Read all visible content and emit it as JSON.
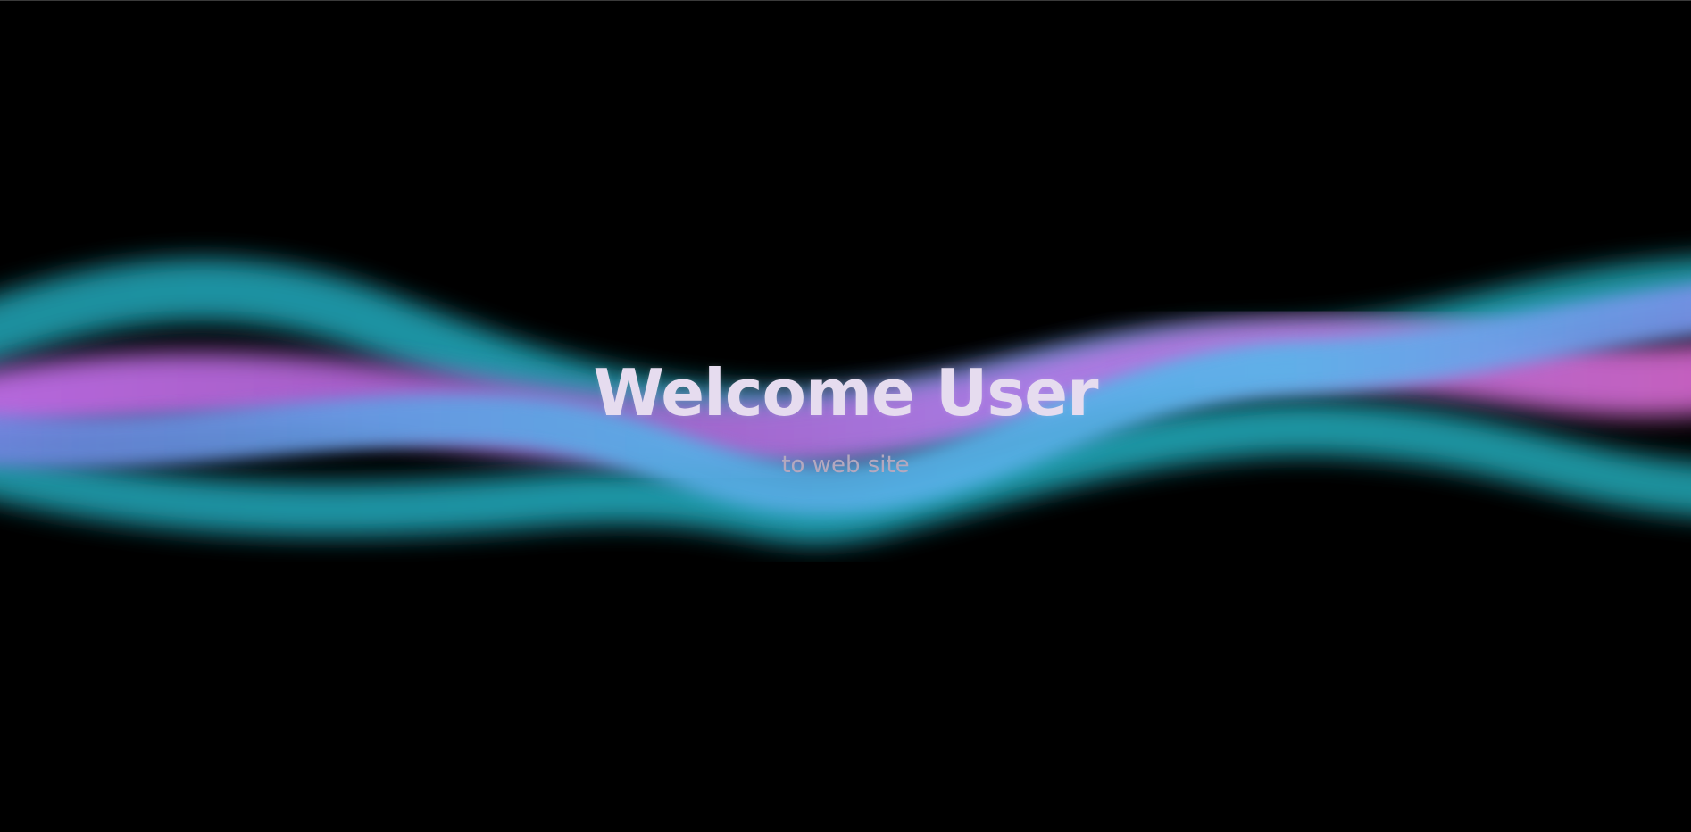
{
  "hero": {
    "title": "Welcome User",
    "subtitle": "to web site"
  },
  "colors": {
    "background": "#000000",
    "title": "#e6dcef",
    "subtitle": "#b4a8bf",
    "wave_teal": "#1a9aa6",
    "wave_blue": "#58aee6",
    "wave_purple": "#c06ee8"
  }
}
